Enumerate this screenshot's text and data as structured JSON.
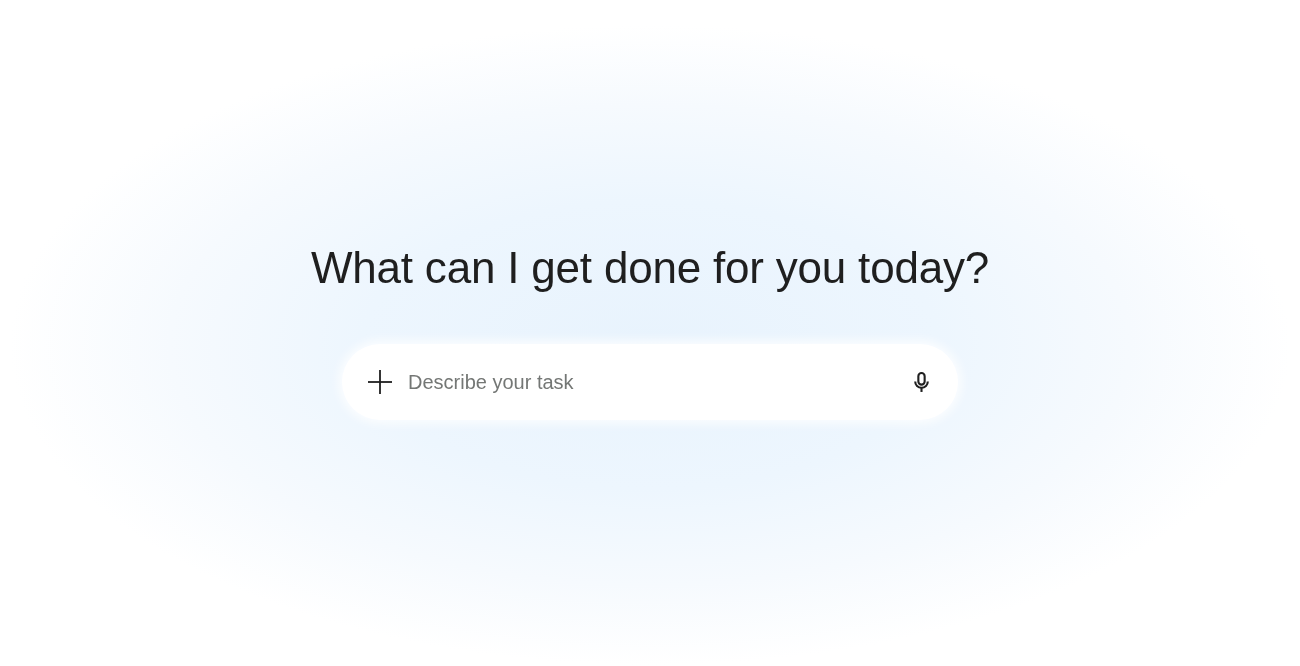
{
  "heading": "What can I get done for you today?",
  "task_field": {
    "placeholder": "Describe your task"
  }
}
